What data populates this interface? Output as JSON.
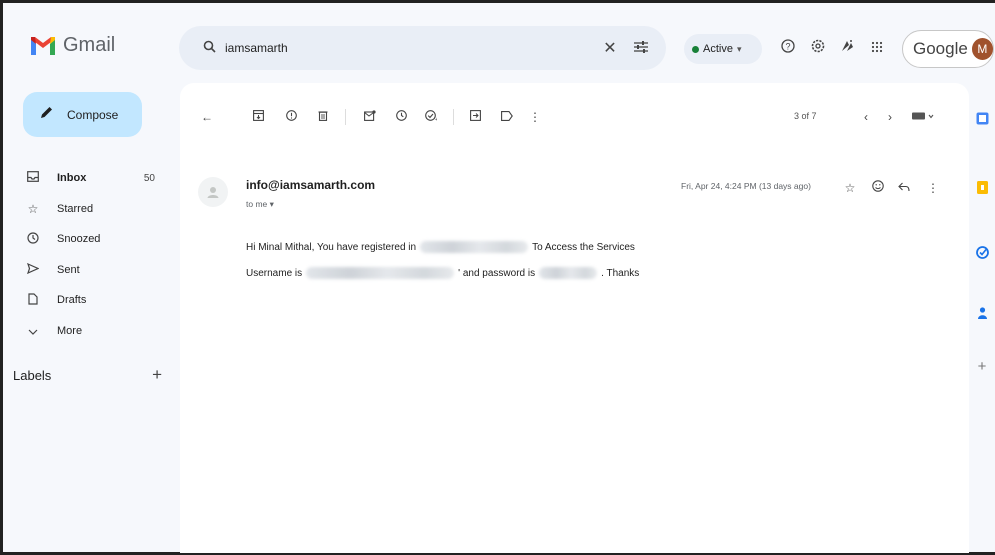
{
  "app": {
    "name": "Gmail"
  },
  "search": {
    "query": "iamsamarth"
  },
  "status": {
    "label": "Active",
    "color": "#188038"
  },
  "account": {
    "brand": "Google",
    "avatar_letter": "M"
  },
  "compose": {
    "label": "Compose"
  },
  "nav": {
    "items": [
      {
        "label": "Inbox",
        "count": "50",
        "icon": "inbox-icon"
      },
      {
        "label": "Starred",
        "icon": "star-icon"
      },
      {
        "label": "Snoozed",
        "icon": "clock-icon"
      },
      {
        "label": "Sent",
        "icon": "send-icon"
      },
      {
        "label": "Drafts",
        "icon": "draft-icon"
      },
      {
        "label": "More",
        "icon": "chevron-down-icon"
      }
    ]
  },
  "labels": {
    "heading": "Labels"
  },
  "toolbar": {
    "pager": "3 of 7"
  },
  "email": {
    "sender": "info@iamsamarth.com",
    "recipient": "to me",
    "date": "Fri, Apr 24, 4:24 PM (13 days ago)",
    "line1_start": "Hi Minal Mithal, You have registered in",
    "line1_end": "To Access the Services",
    "line2_start": "Username is",
    "line2_mid": "' and password is",
    "line2_end": ". Thanks"
  },
  "colors": {
    "accent": "#c2e7ff",
    "background": "#f6f8fc",
    "search_bg": "#e9eef6"
  }
}
